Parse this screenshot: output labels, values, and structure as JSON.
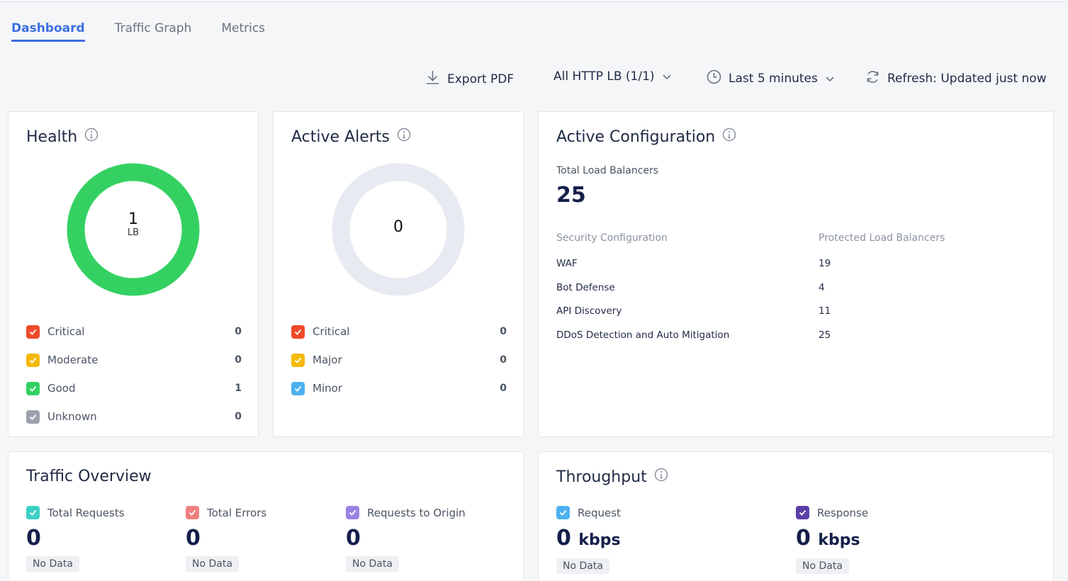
{
  "tabs": [
    {
      "label": "Dashboard",
      "active": true
    },
    {
      "label": "Traffic Graph",
      "active": false
    },
    {
      "label": "Metrics",
      "active": false
    }
  ],
  "toolbar": {
    "export_label": "Export PDF",
    "lb_selector": "All HTTP LB (1/1)",
    "time_range": "Last 5 minutes",
    "refresh_label": "Refresh: Updated just now"
  },
  "health": {
    "title": "Health",
    "center_value": "1",
    "center_unit": "LB",
    "ring_color": "#34d162",
    "legend": [
      {
        "label": "Critical",
        "count": "0",
        "color": "#f04a2a"
      },
      {
        "label": "Moderate",
        "count": "0",
        "color": "#f5b90a"
      },
      {
        "label": "Good",
        "count": "1",
        "color": "#34d162"
      },
      {
        "label": "Unknown",
        "count": "0",
        "color": "#9aa1ad"
      }
    ]
  },
  "alerts": {
    "title": "Active Alerts",
    "center_value": "0",
    "ring_color": "#e8eaf1",
    "legend": [
      {
        "label": "Critical",
        "count": "0",
        "color": "#f04a2a"
      },
      {
        "label": "Major",
        "count": "0",
        "color": "#f5b90a"
      },
      {
        "label": "Minor",
        "count": "0",
        "color": "#4db1f0"
      }
    ]
  },
  "config": {
    "title": "Active Configuration",
    "total_label": "Total Load Balancers",
    "total_value": "25",
    "col1_header": "Security Configuration",
    "col2_header": "Protected Load Balancers",
    "rows": [
      {
        "name": "WAF",
        "value": "19"
      },
      {
        "name": "Bot Defense",
        "value": "4"
      },
      {
        "name": "API Discovery",
        "value": "11"
      },
      {
        "name": "DDoS Detection and Auto Mitigation",
        "value": "25"
      }
    ]
  },
  "traffic": {
    "title": "Traffic Overview",
    "metrics": [
      {
        "label": "Total Requests",
        "value": "0",
        "status": "No Data",
        "color": "#3ccfc6"
      },
      {
        "label": "Total Errors",
        "value": "0",
        "status": "No Data",
        "color": "#f08080"
      },
      {
        "label": "Requests to Origin",
        "value": "0",
        "status": "No Data",
        "color": "#9b82e0"
      }
    ]
  },
  "throughput": {
    "title": "Throughput",
    "metrics": [
      {
        "label": "Request",
        "value": "0",
        "unit": "kbps",
        "status": "No Data",
        "color": "#4db1f0"
      },
      {
        "label": "Response",
        "value": "0",
        "unit": "kbps",
        "status": "No Data",
        "color": "#5a3ea8"
      }
    ]
  }
}
